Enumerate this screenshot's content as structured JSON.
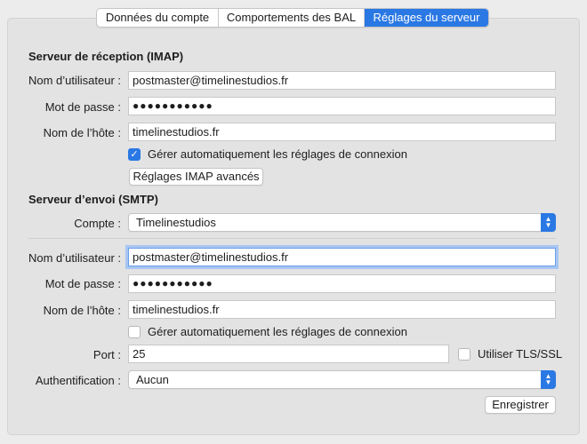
{
  "tabs": [
    {
      "label": "Données du compte",
      "active": false
    },
    {
      "label": "Comportements des BAL",
      "active": false
    },
    {
      "label": "Réglages du serveur",
      "active": true
    }
  ],
  "imap": {
    "title": "Serveur de réception (IMAP)",
    "username_label": "Nom d’utilisateur :",
    "username_value": "postmaster@timelinestudios.fr",
    "password_label": "Mot de passe :",
    "password_value": "●●●●●●●●●●●",
    "host_label": "Nom de l’hôte :",
    "host_value": "timelinestudios.fr",
    "auto_manage_label": "Gérer automatiquement les réglages de connexion",
    "auto_manage_checked": true,
    "advanced_button": "Réglages IMAP avancés"
  },
  "smtp": {
    "title": "Serveur d’envoi (SMTP)",
    "account_label": "Compte :",
    "account_value": "Timelinestudios",
    "username_label": "Nom d’utilisateur :",
    "username_value": "postmaster@timelinestudios.fr",
    "password_label": "Mot de passe :",
    "password_value": "●●●●●●●●●●●",
    "host_label": "Nom de l’hôte :",
    "host_value": "timelinestudios.fr",
    "auto_manage_label": "Gérer automatiquement les réglages de connexion",
    "auto_manage_checked": false,
    "port_label": "Port :",
    "port_value": "25",
    "tls_label": "Utiliser TLS/SSL",
    "tls_checked": false,
    "auth_label": "Authentification :",
    "auth_value": "Aucun"
  },
  "save_button": "Enregistrer",
  "colors": {
    "accent": "#2a78e4",
    "background": "#ececec",
    "panel": "#e3e3e3",
    "focus_ring": "#a7c6f2"
  },
  "icons": {
    "check": "checkmark-icon",
    "select": "chevron-updown-icon"
  }
}
